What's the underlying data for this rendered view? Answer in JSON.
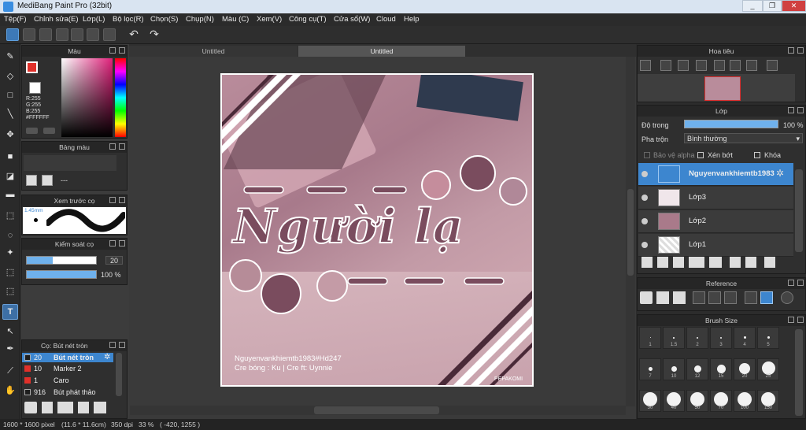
{
  "window": {
    "title": "MediBang Paint Pro (32bit)",
    "controls": [
      "_",
      "❐",
      "✕"
    ]
  },
  "menu": [
    "Tệp(F)",
    "Chỉnh sửa(E)",
    "Lớp(L)",
    "Bộ lọc(R)",
    "Chọn(S)",
    "Chụp(N)",
    "Màu (C)",
    "Xem(V)",
    "Công cụ(T)",
    "Cửa sổ(W)",
    "Cloud",
    "Help"
  ],
  "tabs": [
    "Untitled",
    "Untitled"
  ],
  "color_panel": {
    "title": "Màu",
    "r": "R:255",
    "g": "G:255",
    "b": "B:255",
    "hex": "#FFFFFF",
    "fg": "#e0302a",
    "bg": "#ffffff"
  },
  "palette_panel": {
    "title": "Bảng màu",
    "name": "---"
  },
  "brush_preview": {
    "title": "Xem trước cọ",
    "size": "1.45mm"
  },
  "brush_control": {
    "title": "Kiểm soát cọ",
    "size": "20",
    "opacity": "100 %"
  },
  "brush_list": {
    "title": "Cọ: Bút nét tròn",
    "items": [
      {
        "size": "20",
        "name": "Bút nét tròn",
        "color": "#1e1e1e"
      },
      {
        "size": "10",
        "name": "Marker 2",
        "color": "#e0302a"
      },
      {
        "size": "1",
        "name": "Caro",
        "color": "#e0302a"
      },
      {
        "size": "916",
        "name": "Bút phát thảo",
        "color": "#1e1e1e"
      }
    ]
  },
  "navigator": {
    "title": "Hoa tiêu"
  },
  "layers": {
    "title": "Lớp",
    "opacity_label": "Độ trong",
    "opacity": "100 %",
    "blend_label": "Pha trộn",
    "blend": "Bình thường",
    "protect_alpha": "Bảo vệ alpha",
    "clip": "Xén bớt",
    "lock": "Khóa",
    "items": [
      "Nguyenvankhiemtb1983",
      "Lớp3",
      "Lớp2",
      "Lớp1"
    ]
  },
  "reference": {
    "title": "Reference"
  },
  "brush_size": {
    "title": "Brush Size",
    "sizes": [
      "1",
      "1.5",
      "2",
      "3",
      "4",
      "5",
      "7",
      "10",
      "12",
      "15",
      "20",
      "25",
      "30",
      "40",
      "50",
      "70",
      "100",
      "150"
    ]
  },
  "artwork": {
    "title_text": "Người lạ",
    "credit_1": "Nguyenvankhiemtb1983#Hd247",
    "credit_2": "Cre bóng : Ku | Cre ft: Uynnie",
    "signature": "PEPAKOMI"
  },
  "status": {
    "size": "1600 * 1600 pixel",
    "cm": "(11.6 * 11.6cm)",
    "dpi": "350 dpi",
    "zoom": "33 %",
    "coords": "( -420, 1255 )"
  },
  "colors": {
    "accent": "#3d86cf",
    "panel": "#2f2f2f"
  }
}
